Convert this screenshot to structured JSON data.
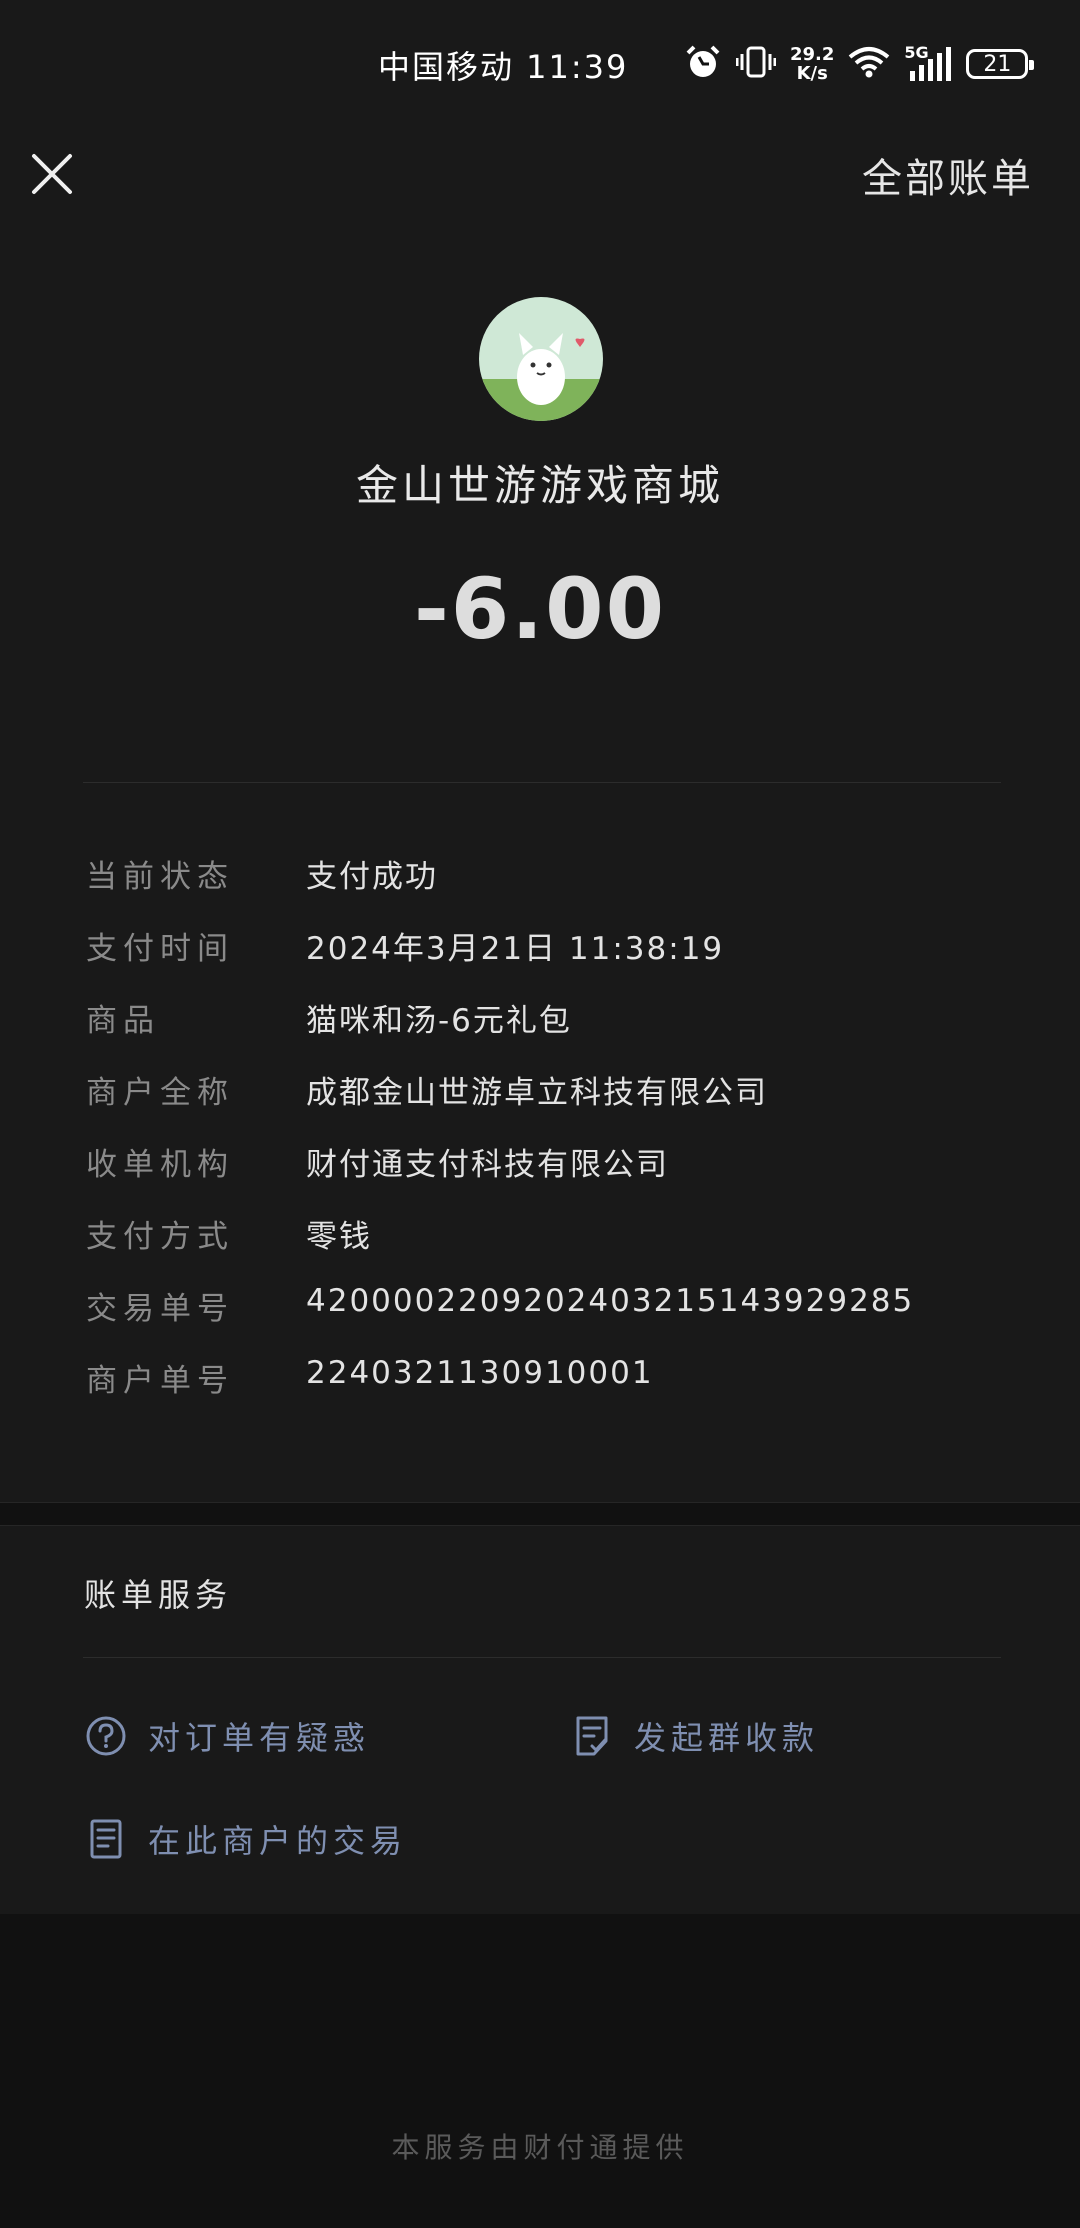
{
  "status_bar": {
    "carrier_time": "中国移动 11:39",
    "net_speed_value": "29.2",
    "net_speed_unit": "K/s",
    "network": "5G",
    "battery": "21"
  },
  "header": {
    "all_bills_label": "全部账单"
  },
  "merchant": {
    "name": "金山世游游戏商城",
    "amount": "-6.00"
  },
  "details": [
    {
      "label": "当前状态",
      "value": "支付成功"
    },
    {
      "label": "支付时间",
      "value": "2024年3月21日 11:38:19"
    },
    {
      "label": "商品",
      "value": "猫咪和汤-6元礼包"
    },
    {
      "label": "商户全称",
      "value": "成都金山世游卓立科技有限公司"
    },
    {
      "label": "收单机构",
      "value": "财付通支付科技有限公司"
    },
    {
      "label": "支付方式",
      "value": "零钱"
    },
    {
      "label": "交易单号",
      "value": "4200002209202403215143929285"
    },
    {
      "label": "商户单号",
      "value": "2240321130910001"
    }
  ],
  "services": {
    "title": "账单服务",
    "items": [
      {
        "label": "对订单有疑惑",
        "icon": "question-circle-icon"
      },
      {
        "label": "发起群收款",
        "icon": "checklist-icon"
      },
      {
        "label": "在此商户的交易",
        "icon": "document-icon"
      }
    ]
  },
  "footer": {
    "text": "本服务由财付通提供"
  },
  "colors": {
    "background": "#191919",
    "link": "#7f8fb1",
    "label": "#8a8a8a"
  }
}
